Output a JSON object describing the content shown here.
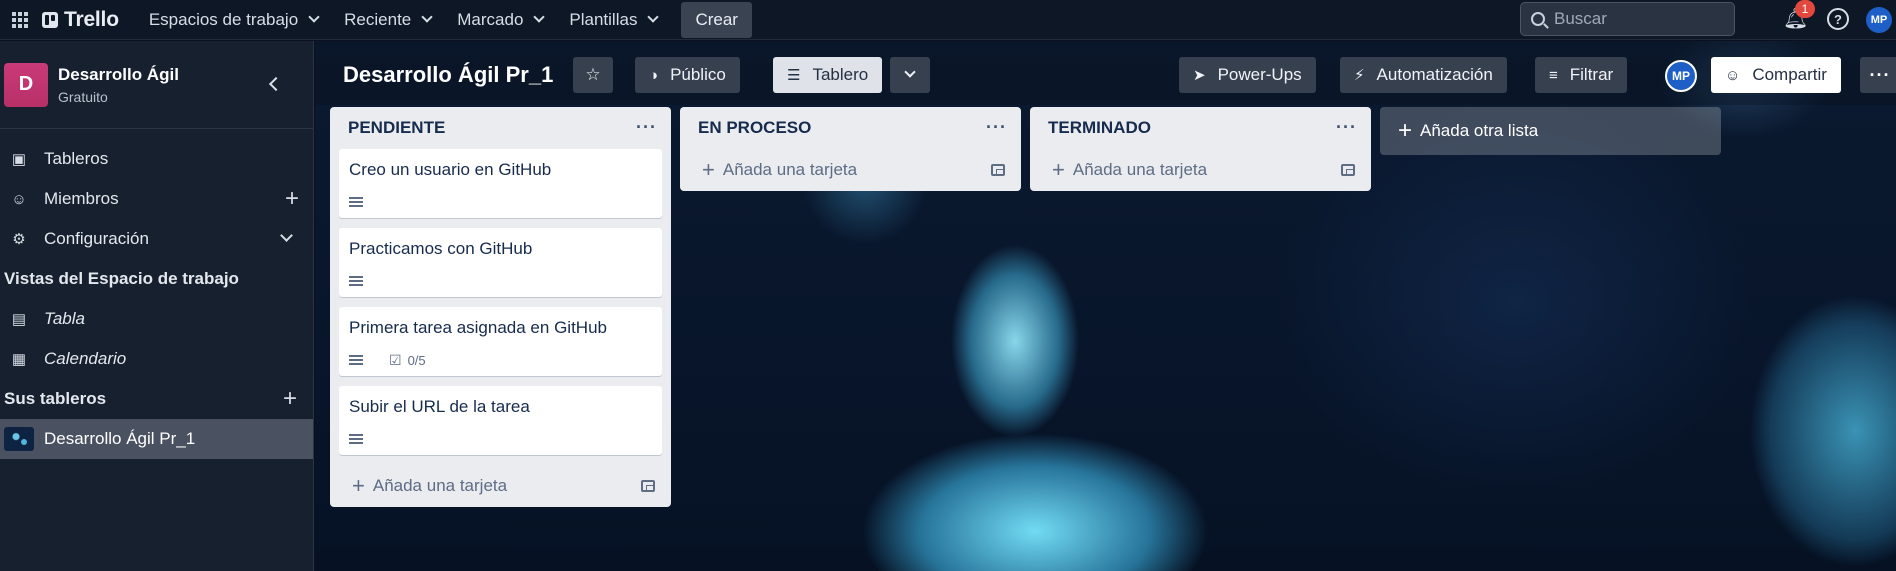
{
  "topbar": {
    "logo": "Trello",
    "nav": [
      {
        "label": "Espacios de trabajo"
      },
      {
        "label": "Reciente"
      },
      {
        "label": "Marcado"
      },
      {
        "label": "Plantillas"
      }
    ],
    "create_label": "Crear",
    "search_placeholder": "Buscar",
    "notification_count": "1",
    "help_label": "?",
    "user_initials": "MP"
  },
  "sidebar": {
    "workspace_initial": "D",
    "workspace_name": "Desarrollo Ágil",
    "workspace_plan": "Gratuito",
    "items": [
      {
        "label": "Tableros"
      },
      {
        "label": "Miembros"
      },
      {
        "label": "Configuración"
      }
    ],
    "views_title": "Vistas del Espacio de trabajo",
    "views": [
      {
        "label": "Tabla"
      },
      {
        "label": "Calendario"
      }
    ],
    "boards_title": "Sus tableros",
    "boards": [
      {
        "label": "Desarrollo Ágil Pr_1"
      }
    ]
  },
  "board": {
    "title": "Desarrollo Ágil Pr_1",
    "visibility_label": "Público",
    "view_label": "Tablero",
    "powerups_label": "Power-Ups",
    "automation_label": "Automatización",
    "filter_label": "Filtrar",
    "member_initials": "MP",
    "share_label": "Compartir",
    "lists": [
      {
        "title": "PENDIENTE",
        "cards": [
          {
            "title": "Creo un usuario en GitHub"
          },
          {
            "title": "Practicamos con GitHub"
          },
          {
            "title": "Primera tarea asignada en GitHub",
            "checklist": "0/5"
          },
          {
            "title": "Subir el URL de la tarea"
          }
        ],
        "add_card_label": "Añada una tarjeta"
      },
      {
        "title": "EN PROCESO",
        "cards": [],
        "add_card_label": "Añada una tarjeta"
      },
      {
        "title": "TERMINADO",
        "cards": [],
        "add_card_label": "Añada una tarjeta"
      }
    ],
    "add_list_label": "Añada otra lista"
  },
  "colors": {
    "topbar_bg": "#0e1726",
    "sidebar_bg": "#16202e",
    "workspace_logo": "#c93a78",
    "list_bg": "#ebecf0",
    "avatar": "#1d5fc7",
    "badge": "#e2483d"
  }
}
